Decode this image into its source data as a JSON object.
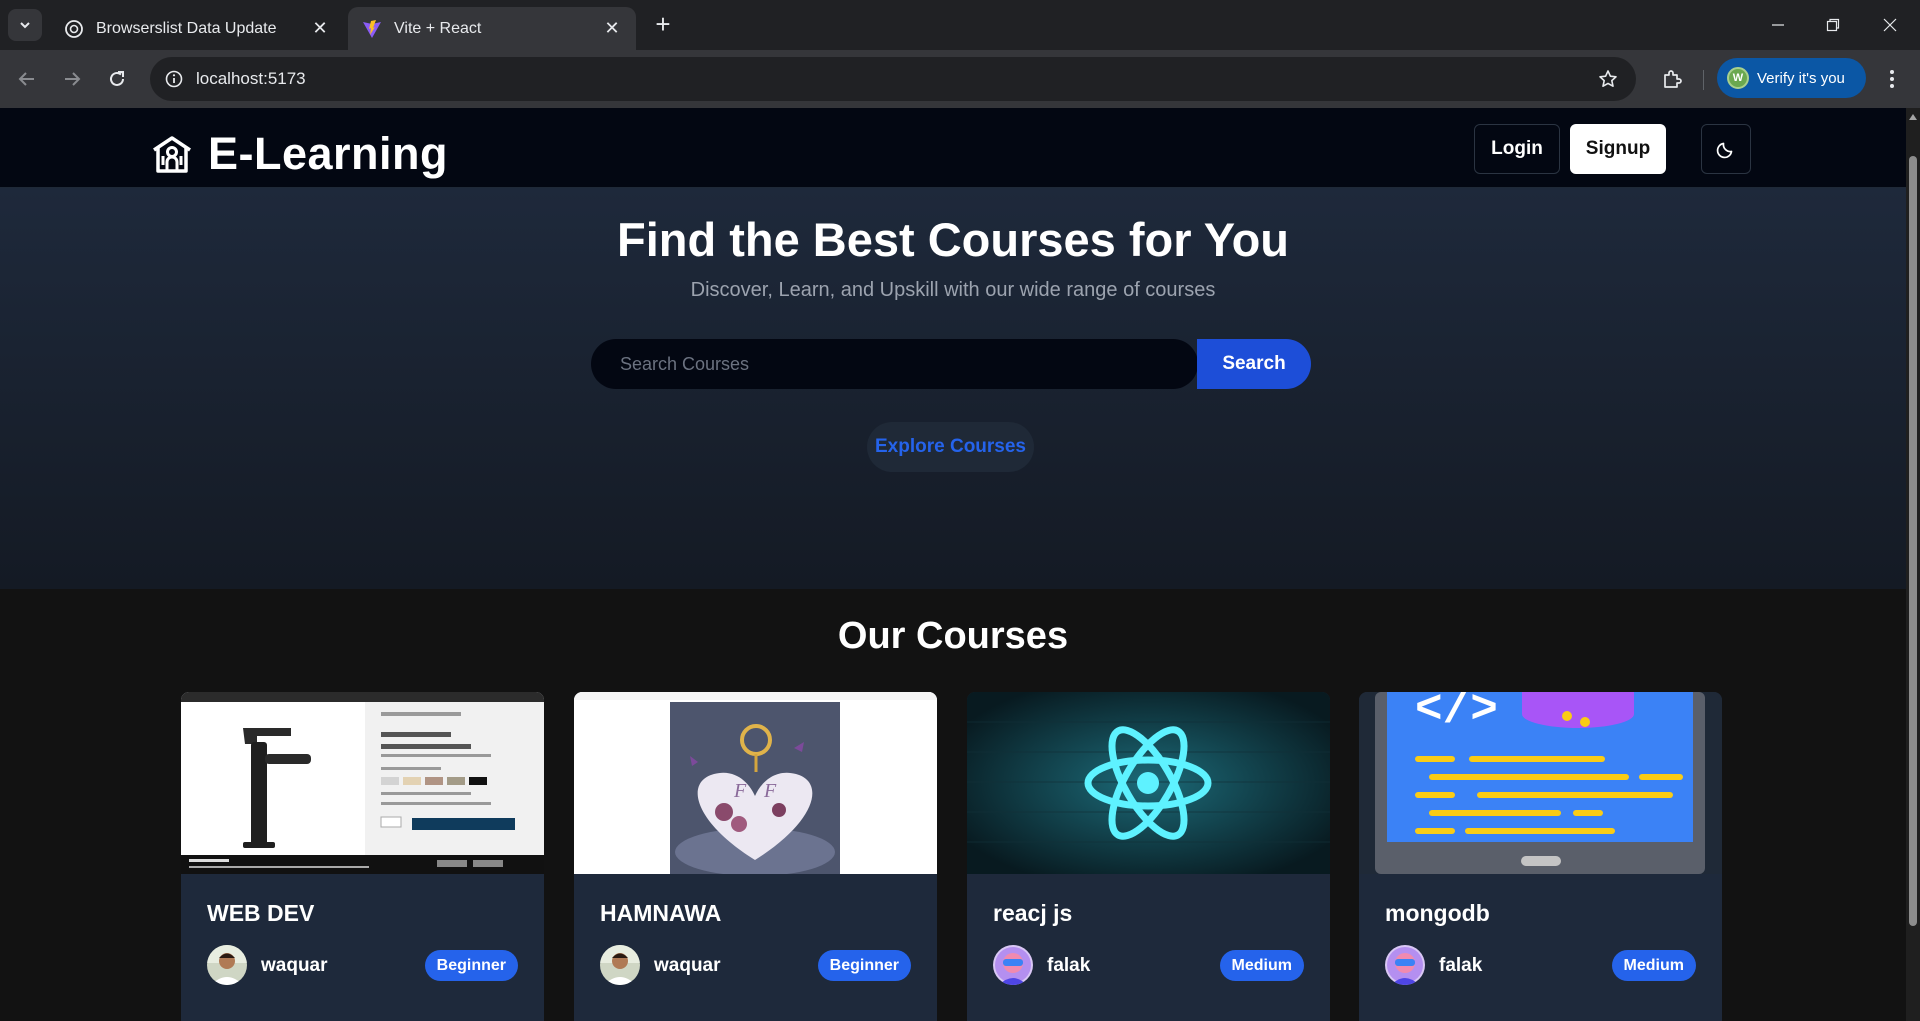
{
  "browser": {
    "tabs": [
      {
        "title": "Browserslist Data Update",
        "icon": "chatgpt-icon",
        "active": false
      },
      {
        "title": "Vite + React",
        "icon": "vite-icon",
        "active": true
      }
    ],
    "url": "localhost:5173",
    "profile_chip": {
      "label": "Verify it's you",
      "avatar_letter": "W"
    }
  },
  "site": {
    "brand": "E-Learning",
    "nav": {
      "login": "Login",
      "signup": "Signup",
      "theme_toggle_icon": "moon-icon"
    }
  },
  "hero": {
    "title": "Find the Best Courses for You",
    "subtitle": "Discover, Learn, and Upskill with our wide range of courses",
    "search": {
      "placeholder": "Search Courses",
      "value": "",
      "button": "Search"
    },
    "explore": "Explore Courses"
  },
  "courses": {
    "title": "Our Courses",
    "items": [
      {
        "name": "WEB DEV",
        "author": "waquar",
        "level": "Beginner",
        "thumbnail": "screenshot-faucet-product"
      },
      {
        "name": "HAMNAWA",
        "author": "waquar",
        "level": "Beginner",
        "thumbnail": "heart-keychain-image"
      },
      {
        "name": "reacj js",
        "author": "falak",
        "level": "Medium",
        "thumbnail": "react-logo-neon"
      },
      {
        "name": "mongodb",
        "author": "falak",
        "level": "Medium",
        "thumbnail": "code-laptop-illustration"
      }
    ]
  },
  "colors": {
    "accent": "#2563eb",
    "nav_bg": "#030712",
    "hero_bg": "#1e293b",
    "card_bg": "#1e293b",
    "chrome_bg": "#202124"
  }
}
